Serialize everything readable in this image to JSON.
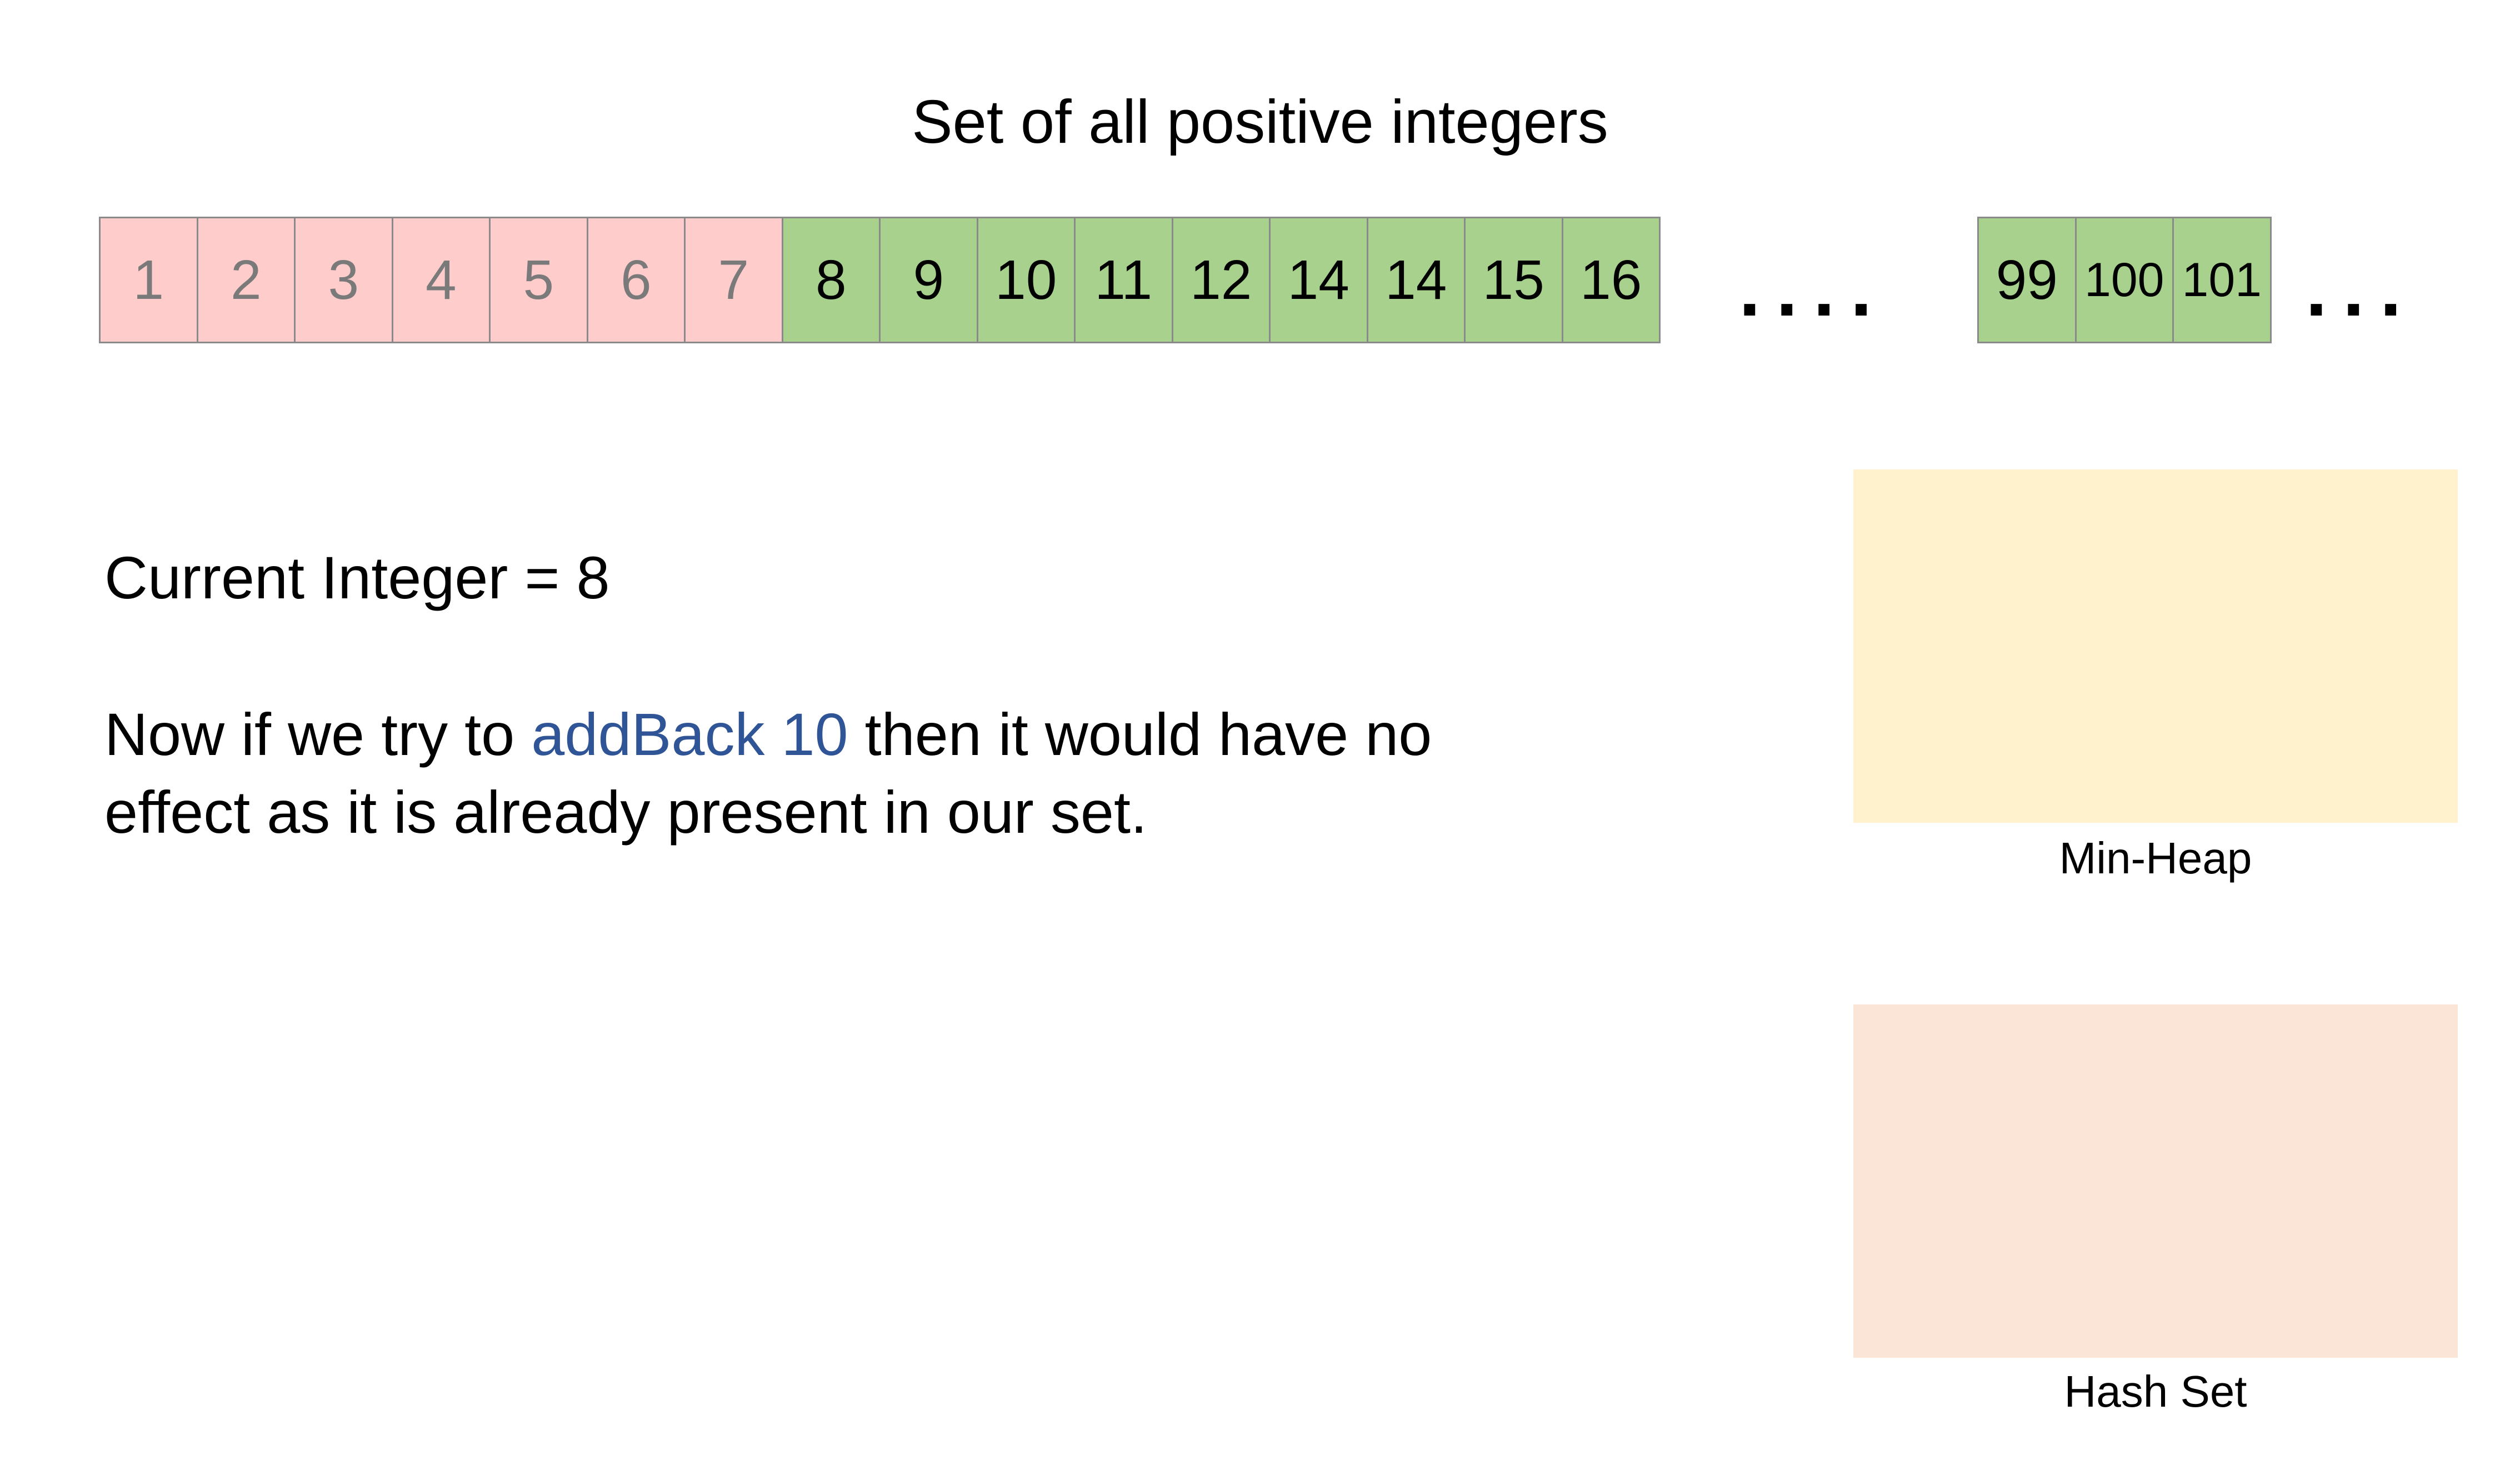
{
  "title": "Set of all positive integers",
  "colors": {
    "removed_fill": "#ffcccc",
    "present_fill": "#a9d18e",
    "min_heap_fill": "#fff2cc",
    "hash_set_fill": "#fbe5d6",
    "highlight_text": "#2f5597"
  },
  "integer_row": {
    "segment_1": [
      {
        "label": "1",
        "state": "removed"
      },
      {
        "label": "2",
        "state": "removed"
      },
      {
        "label": "3",
        "state": "removed"
      },
      {
        "label": "4",
        "state": "removed"
      },
      {
        "label": "5",
        "state": "removed"
      },
      {
        "label": "6",
        "state": "removed"
      },
      {
        "label": "7",
        "state": "removed"
      },
      {
        "label": "8",
        "state": "present"
      },
      {
        "label": "9",
        "state": "present"
      },
      {
        "label": "10",
        "state": "present"
      },
      {
        "label": "11",
        "state": "present"
      },
      {
        "label": "12",
        "state": "present"
      },
      {
        "label": "14",
        "state": "present"
      },
      {
        "label": "14",
        "state": "present"
      },
      {
        "label": "15",
        "state": "present"
      },
      {
        "label": "16",
        "state": "present"
      }
    ],
    "ellipsis_1": "....",
    "segment_2": [
      {
        "label": "99",
        "state": "present"
      },
      {
        "label": "100",
        "state": "present"
      },
      {
        "label": "101",
        "state": "present"
      }
    ],
    "ellipsis_2": "..."
  },
  "current_integer": "Current Integer = 8",
  "explanation": {
    "before": "Now if we try to ",
    "highlight": "addBack 10",
    "after": " then it would have no",
    "line2": "effect as it is already present in our set."
  },
  "min_heap": {
    "label": "Min-Heap"
  },
  "hash_set": {
    "label": "Hash Set"
  }
}
